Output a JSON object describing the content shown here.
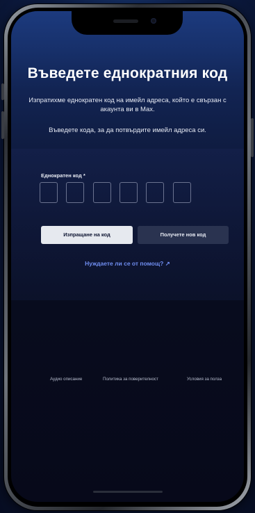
{
  "page": {
    "title": "Въведете еднократния код",
    "subtitle": "Изпратихме еднократен код на имейл адреса, който е свързан с акаунта ви в Max.",
    "instruction": "Въведете кода, за да потвърдите имейл адреса си."
  },
  "form": {
    "code_label": "Еднократен код *",
    "code_boxes": [
      "",
      "",
      "",
      "",
      "",
      ""
    ]
  },
  "buttons": {
    "submit_label": "Изпращане на код",
    "resend_label": "Получете нов код"
  },
  "help": {
    "link_label": "Нуждаете ли се от помощ? ↗"
  },
  "footer": {
    "links": [
      "Аудио описание",
      "Политика за поверителност",
      "Условия за полза"
    ]
  }
}
